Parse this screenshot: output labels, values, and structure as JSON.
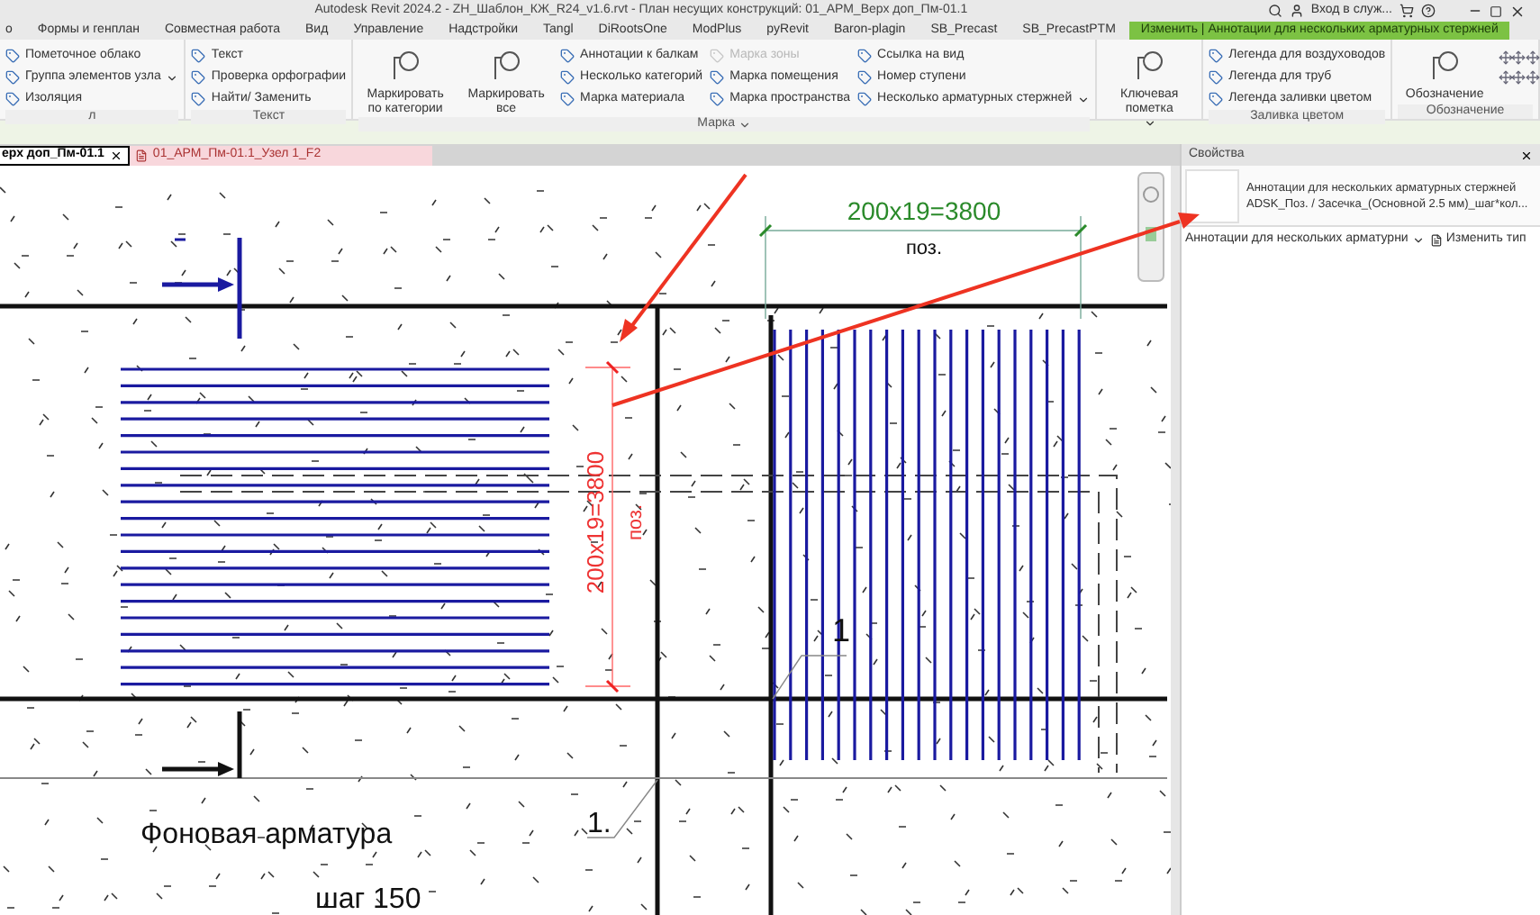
{
  "title_bar": {
    "title": "Autodesk Revit 2024.2 - ZH_Шаблон_КЖ_R24_v1.6.rvt - План несущих конструкций: 01_АРМ_Верх доп_Пм-01.1",
    "sign_in": "Вход в служ..."
  },
  "ribbon_tabs": [
    {
      "label": "о",
      "selected": false
    },
    {
      "label": "Формы и генплан",
      "selected": false
    },
    {
      "label": "Совместная работа",
      "selected": false
    },
    {
      "label": "Вид",
      "selected": false
    },
    {
      "label": "Управление",
      "selected": false
    },
    {
      "label": "Надстройки",
      "selected": false
    },
    {
      "label": "Tangl",
      "selected": false
    },
    {
      "label": "DiRootsOne",
      "selected": false
    },
    {
      "label": "ModPlus",
      "selected": false
    },
    {
      "label": "pyRevit",
      "selected": false
    },
    {
      "label": "Baron-plagin",
      "selected": false
    },
    {
      "label": "SB_Precast",
      "selected": false
    },
    {
      "label": "SB_PrecastPTM",
      "selected": false
    },
    {
      "label": "Изменить | Аннотации для нескольких арматурных стержней",
      "selected": true
    }
  ],
  "ribbon_groups": [
    {
      "title": "л",
      "dropdown": false,
      "columns": [
        [
          {
            "label": "Пометочное облако",
            "kind": "small",
            "disabled": false,
            "dropdown": false
          },
          {
            "label": "Группа элементов узла",
            "kind": "small",
            "disabled": false,
            "dropdown": true
          },
          {
            "label": "Изоляция",
            "kind": "small",
            "disabled": false,
            "dropdown": false
          }
        ]
      ]
    },
    {
      "title": "Текст",
      "dropdown": false,
      "columns": [
        [
          {
            "label": "Текст",
            "kind": "small",
            "disabled": false,
            "dropdown": false
          },
          {
            "label": "Проверка орфографии",
            "kind": "small",
            "disabled": false,
            "dropdown": false
          },
          {
            "label": "Найти/ Заменить",
            "kind": "small",
            "disabled": false,
            "dropdown": false
          }
        ]
      ]
    },
    {
      "title": "Марка",
      "dropdown": true,
      "columns": [
        [
          {
            "label": "Маркировать по категории",
            "kind": "large",
            "disabled": false,
            "dropdown": false
          }
        ],
        [
          {
            "label": "Маркировать все",
            "kind": "large",
            "disabled": false,
            "dropdown": false
          }
        ],
        [
          {
            "label": "Аннотации к балкам",
            "kind": "small",
            "disabled": false,
            "dropdown": false
          },
          {
            "label": "Несколько категорий",
            "kind": "small",
            "disabled": false,
            "dropdown": false
          },
          {
            "label": "Марка материала",
            "kind": "small",
            "disabled": false,
            "dropdown": false
          }
        ],
        [
          {
            "label": "Марка зоны",
            "kind": "small",
            "disabled": true,
            "dropdown": false
          },
          {
            "label": "Марка помещения",
            "kind": "small",
            "disabled": false,
            "dropdown": false
          },
          {
            "label": "Марка пространства",
            "kind": "small",
            "disabled": false,
            "dropdown": false
          }
        ],
        [
          {
            "label": "Ссылка на вид",
            "kind": "small",
            "disabled": false,
            "dropdown": false
          },
          {
            "label": "Номер  ступени",
            "kind": "small",
            "disabled": false,
            "dropdown": false
          },
          {
            "label": "Несколько  арматурных стержней",
            "kind": "small",
            "disabled": false,
            "dropdown": true
          }
        ]
      ]
    },
    {
      "columns": [
        [
          {
            "label": "Ключевая пометка",
            "kind": "large",
            "disabled": false,
            "dropdown": true
          }
        ]
      ]
    },
    {
      "title": "Заливка цветом",
      "dropdown": false,
      "columns": [
        [
          {
            "label": "Легенда для воздуховодов",
            "kind": "small",
            "disabled": false,
            "dropdown": false
          },
          {
            "label": "Легенда для труб",
            "kind": "small",
            "disabled": false,
            "dropdown": false
          },
          {
            "label": "Легенда заливки цветом",
            "kind": "small",
            "disabled": false,
            "dropdown": false
          }
        ]
      ]
    },
    {
      "title": "Обозначение",
      "dropdown": false,
      "columns": [
        [
          {
            "label": "Обозначение",
            "kind": "large",
            "disabled": false,
            "dropdown": false
          }
        ],
        [
          {
            "kind": "tools",
            "disabled": false,
            "dropdown": false
          }
        ]
      ]
    }
  ],
  "view_tabs": [
    {
      "label": "ерх доп_Пм-01.1",
      "selected": true
    },
    {
      "label": "01_АРМ_Пм-01.1_Узел 1_F2",
      "selected": false
    }
  ],
  "canvas": {
    "dimension_top": {
      "value": "200x19=3800",
      "mark": "поз."
    },
    "dimension_side": {
      "value": "200x19=3800",
      "mark": "поз."
    },
    "rebar_tag": "1",
    "leader_tag": "1.",
    "note": "Фоновая арматура",
    "spacing_note": "шаг 150"
  },
  "properties": {
    "title": "Свойства",
    "type_name": "Аннотации для нескольких арматурных стержней",
    "type_detail": "ADSK_Поз. / Засечка_(Основной 2.5 мм)_шаг*кол...",
    "selector": "Аннотации для нескольких арматурни",
    "edit_type": "Изменить тип"
  }
}
